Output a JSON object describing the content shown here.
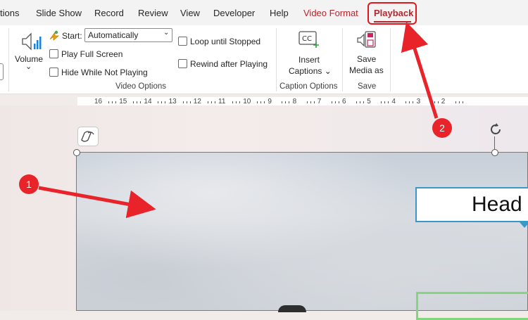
{
  "tabs": [
    {
      "label": "tions"
    },
    {
      "label": "Slide Show"
    },
    {
      "label": "Record"
    },
    {
      "label": "Review"
    },
    {
      "label": "View"
    },
    {
      "label": "Developer"
    },
    {
      "label": "Help"
    },
    {
      "label": "Video Format"
    }
  ],
  "active_tab": {
    "label": "Playback"
  },
  "ribbon": {
    "volume": {
      "label": "Volume",
      "caret": "⌄"
    },
    "start": {
      "label": "Start:",
      "value": "Automatically"
    },
    "play_full_screen": {
      "label": "Play Full Screen",
      "checked": false
    },
    "hide_while_not_playing": {
      "label": "Hide While Not Playing",
      "checked": false
    },
    "loop_until_stopped": {
      "label": "Loop until Stopped",
      "checked": false
    },
    "rewind_after_playing": {
      "label": "Rewind after Playing",
      "checked": false
    },
    "video_options_group": "Video Options",
    "insert_captions": {
      "line1": "Insert",
      "line2": "Captions ⌄"
    },
    "caption_options_group": "Caption Options",
    "save_media": {
      "line1": "Save",
      "line2": "Media as"
    },
    "save_group": "Save"
  },
  "ruler": {
    "labels": [
      "16",
      "15",
      "14",
      "13",
      "12",
      "11",
      "10",
      "9",
      "8",
      "7",
      "6",
      "5",
      "4",
      "3",
      "2"
    ]
  },
  "slide": {
    "heading": "Head"
  },
  "annotations": [
    {
      "label": "1"
    },
    {
      "label": "2"
    }
  ],
  "colors": {
    "accent": "#b4262d",
    "annotation": "#e8242a",
    "heading_border": "#3a97c9",
    "green_box": "#83d57e"
  }
}
